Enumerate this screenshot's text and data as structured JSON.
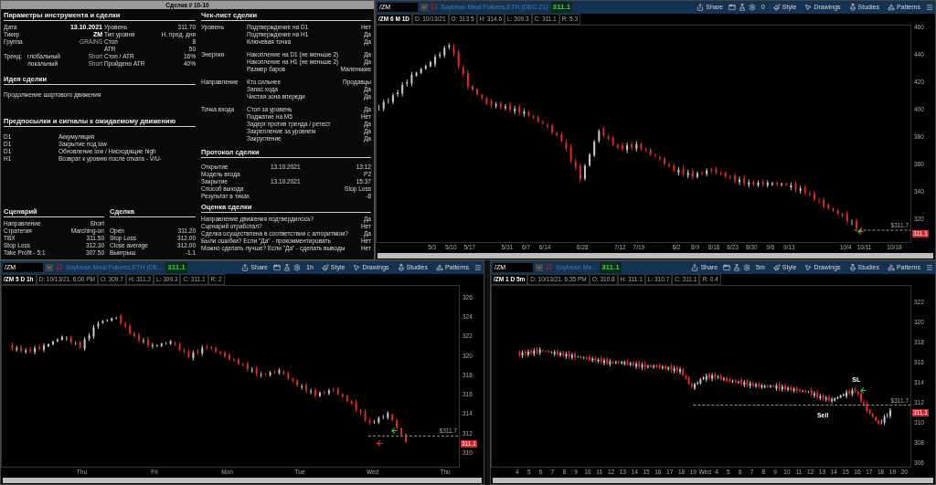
{
  "trade_sheet": {
    "title": "Сделка # 10-10",
    "params": {
      "heading": "Параметры инструмента и сделки",
      "rows": [
        {
          "label": "Дата",
          "sub": "",
          "value": "13.10.2021",
          "label2": "Уровень",
          "value2": "311.70",
          "emphasis": true
        },
        {
          "label": "Тикер",
          "sub": "",
          "value": "ZM",
          "label2": "Тип уровня",
          "value2": "H, пред. дня",
          "emphasis": true
        },
        {
          "label": "Группа",
          "sub": "",
          "value": "GRAINS",
          "label2": "Стоп",
          "value2": "8",
          "emphasis": false
        },
        {
          "label": "",
          "sub": "",
          "value": "",
          "label2": "ATR",
          "value2": "50"
        },
        {
          "label": "Тренд:",
          "sub": "глобальный",
          "value": "Short",
          "label2": "Стоп / ATR",
          "value2": "16%",
          "emphasis": false
        },
        {
          "label": "",
          "sub": "локальный",
          "value": "Short",
          "label2": "Пройдено ATR",
          "value2": "40%",
          "emphasis": false
        }
      ]
    },
    "idea": {
      "heading": "Идея сделки",
      "text": "Продолжение шортового движения"
    },
    "signals": {
      "heading": "Предпосылки и сигналы к ожидаемому движению",
      "rows": [
        {
          "timeframe": "D1",
          "signal": "Аккумуляция"
        },
        {
          "timeframe": "D1",
          "signal": "Закрытие под low"
        },
        {
          "timeframe": "D1",
          "signal": "Обновление low / Нисходящие high"
        },
        {
          "timeframe": "H1",
          "signal": "Возврат к уровню после отката - V/U-"
        }
      ]
    },
    "scenario": {
      "heading": "Сценарий",
      "rows": [
        {
          "label": "Направление",
          "value": "Short"
        },
        {
          "label": "Стратегия",
          "value": "Marching-on"
        },
        {
          "label": "TBX",
          "value": "311.50"
        },
        {
          "label": "Stop Loss",
          "value": "312.30"
        },
        {
          "label": "Take Profit - 5:1",
          "value": "307.50"
        }
      ]
    },
    "deal": {
      "heading": "Сделка",
      "rows": [
        {
          "label": "Open",
          "value": "311.20"
        },
        {
          "label": "Stop Loss",
          "value": "312.00"
        },
        {
          "label": "Close average",
          "value": "312.00"
        },
        {
          "label": "Выигрыш",
          "value": "-1.1"
        }
      ]
    },
    "checklist": {
      "heading": "Чек-лист сделки",
      "groups": [
        {
          "name": "Уровень",
          "items": [
            {
              "label": "Подтверждение на D1",
              "answer": "Нет"
            },
            {
              "label": "Подтверждение на H1",
              "answer": "Да"
            },
            {
              "label": "Ключевая точка",
              "answer": "Да"
            }
          ]
        },
        {
          "name": "Энергия",
          "items": [
            {
              "label": "Накопление на D1 (не меньше 2)",
              "answer": "Да"
            },
            {
              "label": "Накопление на H1 (не меньше 2)",
              "answer": "Да"
            },
            {
              "label": "Размер баров",
              "answer": "Маленькие"
            }
          ]
        },
        {
          "name": "Направление",
          "items": [
            {
              "label": "Кто сильнее",
              "answer": "Продавцы"
            },
            {
              "label": "Запас хода",
              "answer": "Да"
            },
            {
              "label": "Чистая зона впереди",
              "answer": "Да"
            }
          ]
        },
        {
          "name": "Точка входа",
          "items": [
            {
              "label": "Стоп за уровень",
              "answer": "Да"
            },
            {
              "label": "Поджатие на M5",
              "answer": "Нет"
            },
            {
              "label": "Задерг против тренда / ретест",
              "answer": "Да"
            },
            {
              "label": "Закрепление за уровнем",
              "answer": "Да"
            },
            {
              "label": "Закругление",
              "answer": "Да"
            }
          ]
        }
      ]
    },
    "protocol": {
      "heading": "Протокол сделки",
      "rows": [
        {
          "label": "Открытие",
          "date": "13.10.2021",
          "value": "13:12"
        },
        {
          "label": "Модель входа",
          "date": "",
          "value": "P2"
        },
        {
          "label": "Закрытие",
          "date": "13.10.2021",
          "value": "15:37"
        },
        {
          "label": "Способ выхода",
          "date": "",
          "value": "Stop Loss"
        },
        {
          "label": "Результат в тиках",
          "date": "",
          "value": "-8"
        }
      ]
    },
    "evaluation": {
      "heading": "Оценка сделки",
      "rows": [
        {
          "question": "Направление движения подтвердилось?",
          "answer": "Да"
        },
        {
          "question": "Сценарий отработал?",
          "answer": "Нет"
        },
        {
          "question": "Сделка осуществлена в соответствии с алгоритмом?",
          "answer": "Да"
        },
        {
          "question": "Были ошибки? Если \"Да\" - прокомментировать",
          "answer": "Нет"
        },
        {
          "question": "Можно сделать лучше? Если \"Да\" - сделать выводы",
          "answer": "Нет"
        }
      ]
    }
  },
  "charts": [
    {
      "toolbar": {
        "symbol": "/ZM",
        "description": "Soybean Meal Futures,ETH (DEC 21)",
        "price": "311.1",
        "aggregation": "0",
        "price_tag": "311.1",
        "buttons": [
          "Share",
          "Style",
          "Drawings",
          "Studies",
          "Patterns"
        ]
      },
      "info": [
        "/ZM 6 M 1D",
        "D: 10/13/21",
        "O: 313.5",
        "H: 314.6",
        "L: 309.3",
        "C: 311.1",
        "R: 5.3"
      ],
      "price_axis": [
        "460",
        "440",
        "420",
        "400",
        "380",
        "360",
        "340",
        "320"
      ],
      "time_axis": [
        "5/3",
        "5/10",
        "5/17",
        "5/31",
        "6/7",
        "6/14",
        "6/28",
        "7/12",
        "7/19",
        "8/2",
        "8/9",
        "8/16",
        "8/23",
        "8/30",
        "9/6",
        "9/13",
        "10/4",
        "10/11",
        "10/18"
      ],
      "level_label": "$311.7"
    },
    {
      "toolbar": {
        "symbol": "/ZM",
        "description": "Soybean Meal Futures,ETH (DE...",
        "price": "311.1",
        "aggregation": "1h",
        "price_tag": "311.1",
        "buttons": [
          "Share",
          "Style",
          "Drawings",
          "Studies",
          "Patterns"
        ]
      },
      "info": [
        "/ZM 5 D 1h",
        "D: 10/13/21, 6:00 PM",
        "O: 309.7",
        "H: 311.3",
        "L: 309.3",
        "C: 311.1",
        "R: 2"
      ],
      "price_axis": [
        "326",
        "324",
        "322",
        "320",
        "318",
        "316",
        "314",
        "312",
        "310"
      ],
      "time_axis": [
        "Thu",
        "Fri",
        "Mon",
        "Tue",
        "Wed",
        "Thu"
      ],
      "level_label": "$311.7"
    },
    {
      "toolbar": {
        "symbol": "/ZM",
        "description": "Soybean Me...",
        "price": "311.1",
        "aggregation": "5m",
        "price_tag": "311.1",
        "buttons": [
          "Share",
          "Style",
          "Drawings",
          "Studies",
          "Patterns"
        ]
      },
      "info": [
        "/ZM 1 D 5m",
        "D: 10/13/21, 6:35 PM",
        "O: 310.8",
        "H: 311.1",
        "L: 310.7",
        "C: 311.1",
        "R: 0.4"
      ],
      "price_axis": [
        "322",
        "320",
        "318",
        "316",
        "314",
        "312",
        "310",
        "308",
        "306"
      ],
      "time_axis": [
        "4",
        "5",
        "6",
        "7",
        "8",
        "9",
        "10",
        "11",
        "12",
        "13",
        "14",
        "15",
        "16",
        "17",
        "18",
        "19",
        "Wed",
        "4",
        "5",
        "6",
        "7",
        "8",
        "9",
        "10",
        "11",
        "12",
        "13",
        "14",
        "15",
        "16",
        "17",
        "18",
        "19",
        "20"
      ],
      "level_label": "$311.7",
      "markers": [
        "Sell",
        "SL"
      ]
    }
  ]
}
